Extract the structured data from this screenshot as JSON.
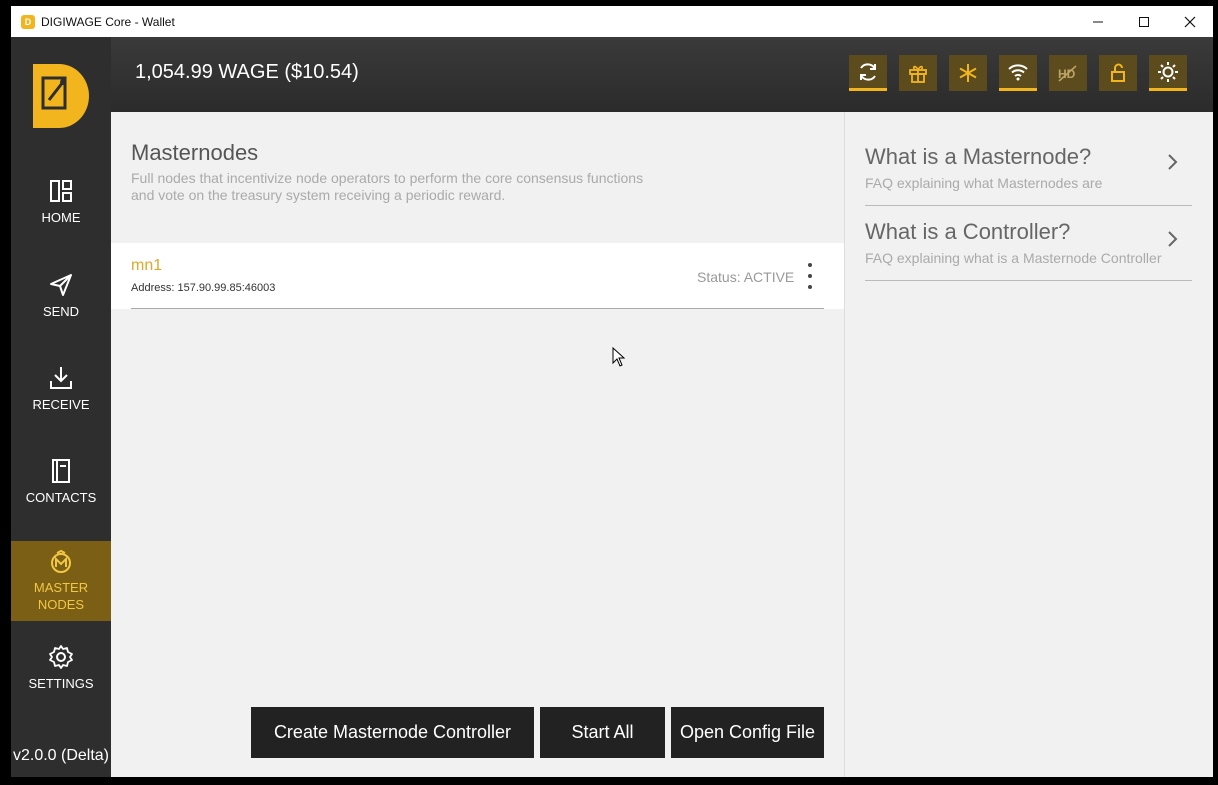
{
  "window": {
    "title": "DIGIWAGE Core - Wallet",
    "controls": [
      "—",
      "☐",
      "✕"
    ]
  },
  "header": {
    "balance": "1,054.99 WAGE ($10.54)",
    "buttons": [
      {
        "icon": "sync-icon",
        "active": true
      },
      {
        "icon": "gift-icon",
        "active": false
      },
      {
        "icon": "snowflake-icon",
        "active": false
      },
      {
        "icon": "wifi-icon",
        "active": true
      },
      {
        "icon": "hd-disabled-icon",
        "active": false
      },
      {
        "icon": "unlock-icon",
        "active": false
      },
      {
        "icon": "sun-icon",
        "active": true
      }
    ],
    "accent": "#f2b51d"
  },
  "sidebar": {
    "items": [
      {
        "label": "HOME",
        "icon": "home-icon"
      },
      {
        "label": "SEND",
        "icon": "send-icon"
      },
      {
        "label": "RECEIVE",
        "icon": "receive-icon"
      },
      {
        "label": "CONTACTS",
        "icon": "contacts-icon"
      },
      {
        "label": "MASTER NODES",
        "icon": "masternode-icon",
        "active": true
      },
      {
        "label": "SETTINGS",
        "icon": "gear-icon"
      }
    ],
    "version": "v2.0.0 (Delta)"
  },
  "main": {
    "title": "Masternodes",
    "description": "Full nodes that incentivize node operators to perform the core consensus functions and vote on the treasury system receiving a periodic reward.",
    "masternodes": [
      {
        "name": "mn1",
        "address": "Address: 157.90.99.85:46003",
        "status": "Status: ACTIVE"
      }
    ],
    "buttons": {
      "create": "Create Masternode Controller",
      "start_all": "Start All",
      "open_config": "Open Config File"
    }
  },
  "faq": [
    {
      "question": "What is a Masternode?",
      "answer": "FAQ explaining what Masternodes are"
    },
    {
      "question": "What is a Controller?",
      "answer": "FAQ explaining what is a Masternode Controller"
    }
  ]
}
